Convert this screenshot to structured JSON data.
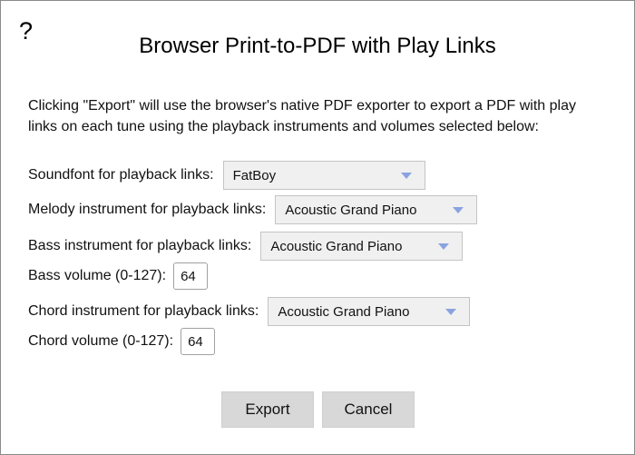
{
  "dialog": {
    "help_label": "?",
    "title": "Browser Print-to-PDF with Play Links",
    "intro": "Clicking \"Export\" will use the browser's native PDF exporter to export a PDF with play links on each tune using the playback instruments and volumes selected below:"
  },
  "fields": {
    "soundfont": {
      "label": "Soundfont for playback links:",
      "value": "FatBoy"
    },
    "melody": {
      "label": "Melody instrument for playback links:",
      "value": "Acoustic Grand Piano"
    },
    "bass": {
      "label": "Bass instrument for playback links:",
      "value": "Acoustic Grand Piano"
    },
    "bass_volume": {
      "label": "Bass volume (0-127):",
      "value": "64"
    },
    "chord": {
      "label": "Chord instrument for playback links:",
      "value": "Acoustic Grand Piano"
    },
    "chord_volume": {
      "label": "Chord volume (0-127):",
      "value": "64"
    }
  },
  "buttons": {
    "export": "Export",
    "cancel": "Cancel"
  },
  "colors": {
    "dropdown_arrow": "#8aa3e0",
    "button_bg": "#d8d8d8",
    "select_bg": "#f0f0f0"
  }
}
